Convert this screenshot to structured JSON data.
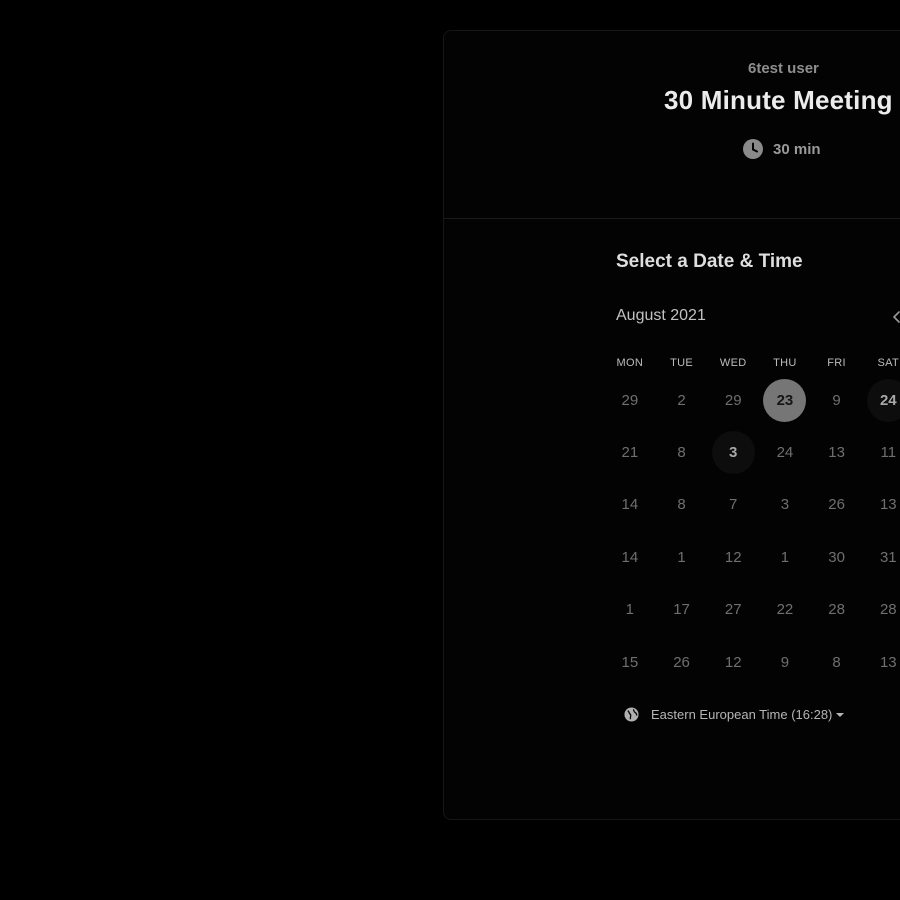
{
  "event": {
    "host": "6test user",
    "title": "30 Minute Meeting",
    "duration": "30 min"
  },
  "scheduler": {
    "section_title": "Select a Date & Time",
    "month": "August 2021",
    "weekdays": [
      "MON",
      "TUE",
      "WED",
      "THU",
      "FRI",
      "SAT"
    ],
    "weeks": [
      [
        {
          "label": "29",
          "state": "disabled"
        },
        {
          "label": "2",
          "state": "disabled"
        },
        {
          "label": "29",
          "state": "disabled"
        },
        {
          "label": "23",
          "state": "selected"
        },
        {
          "label": "9",
          "state": "disabled"
        },
        {
          "label": "24",
          "state": "available"
        }
      ],
      [
        {
          "label": "21",
          "state": "disabled"
        },
        {
          "label": "8",
          "state": "disabled"
        },
        {
          "label": "3",
          "state": "available"
        },
        {
          "label": "24",
          "state": "disabled"
        },
        {
          "label": "13",
          "state": "disabled"
        },
        {
          "label": "11",
          "state": "disabled"
        }
      ],
      [
        {
          "label": "14",
          "state": "disabled"
        },
        {
          "label": "8",
          "state": "disabled"
        },
        {
          "label": "7",
          "state": "disabled"
        },
        {
          "label": "3",
          "state": "disabled"
        },
        {
          "label": "26",
          "state": "disabled"
        },
        {
          "label": "13",
          "state": "disabled"
        }
      ],
      [
        {
          "label": "14",
          "state": "disabled"
        },
        {
          "label": "1",
          "state": "disabled"
        },
        {
          "label": "12",
          "state": "disabled"
        },
        {
          "label": "1",
          "state": "disabled"
        },
        {
          "label": "30",
          "state": "disabled"
        },
        {
          "label": "31",
          "state": "disabled"
        }
      ],
      [
        {
          "label": "1",
          "state": "disabled"
        },
        {
          "label": "17",
          "state": "disabled"
        },
        {
          "label": "27",
          "state": "disabled"
        },
        {
          "label": "22",
          "state": "disabled"
        },
        {
          "label": "28",
          "state": "disabled"
        },
        {
          "label": "28",
          "state": "disabled"
        }
      ],
      [
        {
          "label": "15",
          "state": "disabled"
        },
        {
          "label": "26",
          "state": "disabled"
        },
        {
          "label": "12",
          "state": "disabled"
        },
        {
          "label": "9",
          "state": "disabled"
        },
        {
          "label": "8",
          "state": "disabled"
        },
        {
          "label": "13",
          "state": "disabled"
        }
      ]
    ],
    "timezone": "Eastern European Time (16:28)"
  },
  "icons": {
    "duration": "clock-icon",
    "timezone": "globe-icon",
    "timezone_dropdown": "caret-down-icon",
    "previous_month": "chevron-left-icon"
  },
  "colors": {
    "background": "#000000",
    "selected_day": "#767676",
    "available_day_bg": "#0d0d0d"
  }
}
